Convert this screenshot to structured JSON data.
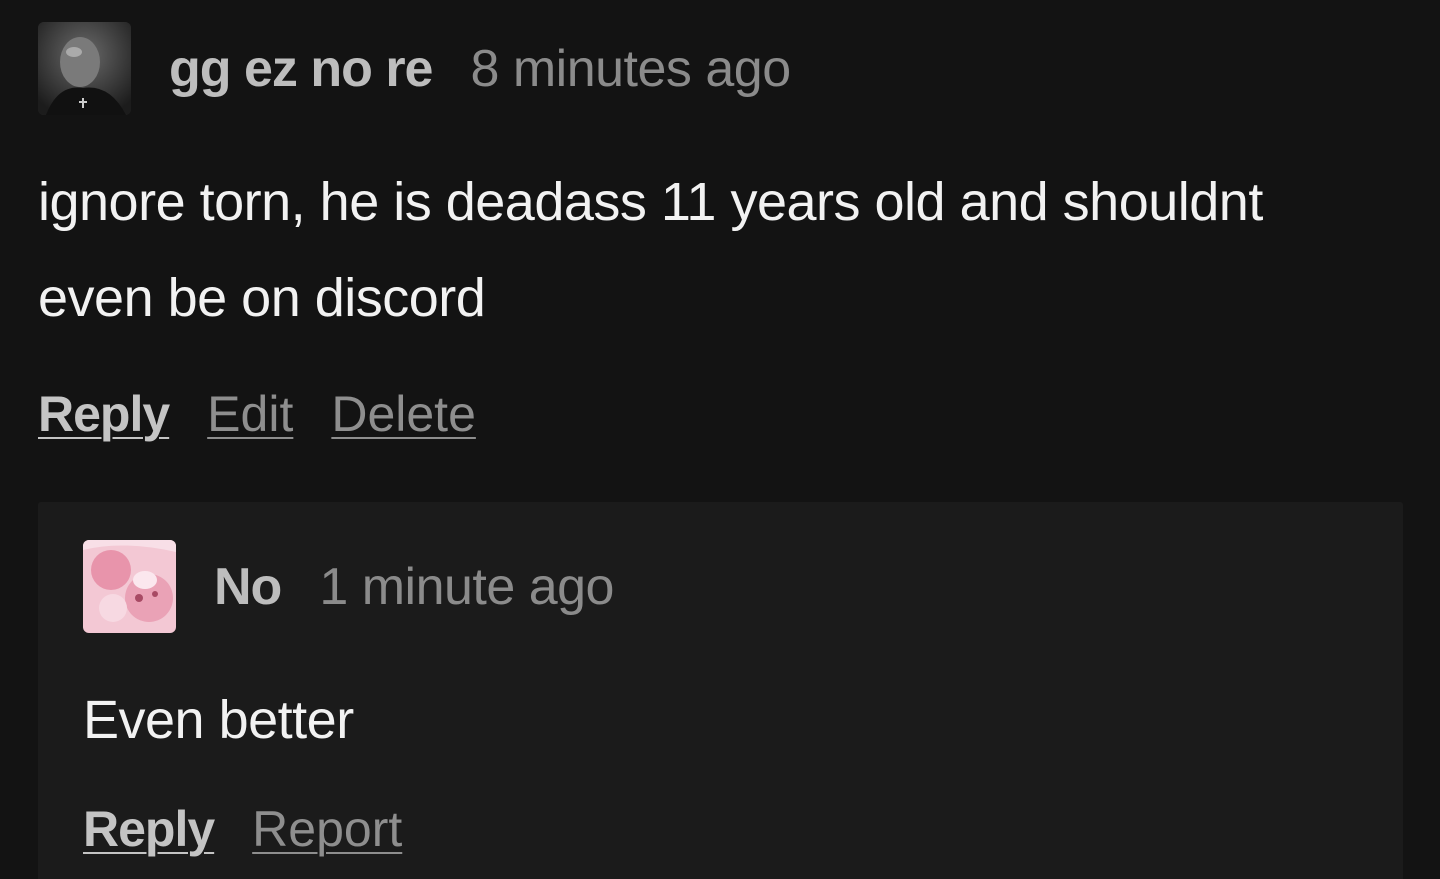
{
  "comment": {
    "author": "gg ez no re",
    "timestamp": "8 minutes ago",
    "body_line1": "ignore torn, he is deadass 11 years old and shouldnt",
    "body_line2": "even be on discord",
    "actions": {
      "reply": "Reply",
      "edit": "Edit",
      "delete": "Delete"
    }
  },
  "reply": {
    "author": "No",
    "timestamp": "1 minute ago",
    "body": "Even better",
    "actions": {
      "reply": "Reply",
      "report": "Report"
    }
  },
  "colors": {
    "background": "#131313",
    "reply_background": "#1b1b1b",
    "author_text": "#bdbdbd",
    "timestamp_text": "#8b8b8b",
    "body_text": "#f2f2f2"
  }
}
